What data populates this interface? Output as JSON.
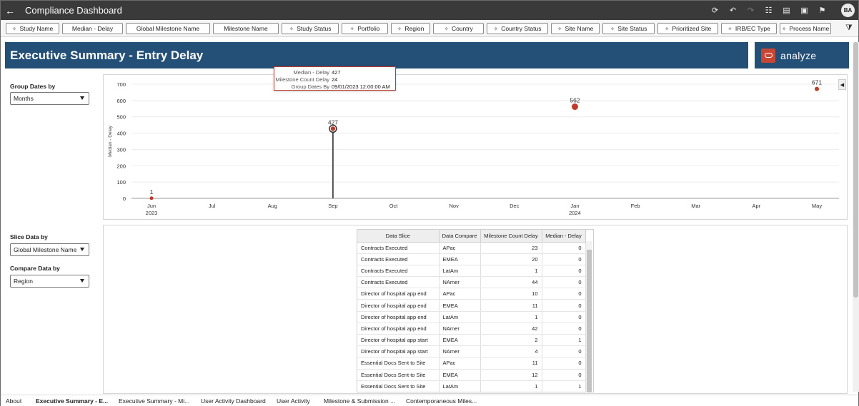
{
  "header": {
    "title": "Compliance Dashboard",
    "avatar": "BA",
    "back_glyph": "←",
    "icons": [
      "refresh-icon",
      "undo-icon",
      "redo-icon",
      "database-icon",
      "comment-icon",
      "export-icon",
      "bookmark-icon"
    ]
  },
  "filters": [
    "Study Name",
    "Median - Delay",
    "Global Milestone Name",
    "Milestone Name",
    "Study Status",
    "Portfolio",
    "Region",
    "Country",
    "Country Status",
    "Site Name",
    "Site Status",
    "Prioritized Site",
    "IRB/EC Type",
    "Process Name"
  ],
  "banner": {
    "title": "Executive Summary - Entry Delay",
    "logo_text": "analyze"
  },
  "controls": {
    "group_dates_label": "Group Dates by",
    "group_dates_value": "Months",
    "slice_label": "Slice Data by",
    "slice_value": "Global Milestone Name",
    "compare_label": "Compare Data by",
    "compare_value": "Region"
  },
  "tooltip": {
    "rows": [
      {
        "key": "Median - Delay",
        "value": "427"
      },
      {
        "key": "Milestone Count Delay",
        "value": "24"
      },
      {
        "key": "Group Dates By",
        "value": "09/01/2023 12:00:00 AM"
      }
    ]
  },
  "chart_data": {
    "type": "scatter",
    "ylabel": "Median - Delay",
    "ylim": [
      0,
      700
    ],
    "yticks": [
      0,
      100,
      200,
      300,
      400,
      500,
      600,
      700
    ],
    "categories": [
      "Jun",
      "Jul",
      "Aug",
      "Sep",
      "Oct",
      "Nov",
      "Dec",
      "Jan",
      "Feb",
      "Mar",
      "Apr",
      "May"
    ],
    "year_labels": [
      {
        "category": "Jun",
        "year": "2023"
      },
      {
        "category": "Jan",
        "year": "2024"
      }
    ],
    "points": [
      {
        "category": "Jun",
        "value": 1,
        "label": "1"
      },
      {
        "category": "Sep",
        "value": 427,
        "label": "427",
        "highlighted": true
      },
      {
        "category": "Jan",
        "value": 562,
        "label": "562"
      },
      {
        "category": "May",
        "value": 671,
        "label": "671"
      }
    ],
    "point_color": "#c0392b",
    "grid": true
  },
  "table": {
    "columns": [
      "Data Slice",
      "Data Compare",
      "Milestone Count Delay",
      "Median - Delay"
    ],
    "rows": [
      [
        "Contracts Executed",
        "APac",
        "23",
        "0"
      ],
      [
        "Contracts Executed",
        "EMEA",
        "20",
        "0"
      ],
      [
        "Contracts Executed",
        "LatAm",
        "1",
        "0"
      ],
      [
        "Contracts Executed",
        "NAmer",
        "44",
        "0"
      ],
      [
        "Director of hospital app end",
        "APac",
        "10",
        "0"
      ],
      [
        "Director of hospital app end",
        "EMEA",
        "11",
        "0"
      ],
      [
        "Director of hospital app end",
        "LatAm",
        "1",
        "0"
      ],
      [
        "Director of hospital app end",
        "NAmer",
        "42",
        "0"
      ],
      [
        "Director of hospital app start",
        "EMEA",
        "2",
        "1"
      ],
      [
        "Director of hospital app start",
        "NAmer",
        "4",
        "0"
      ],
      [
        "Essential Docs Sent to Site",
        "APac",
        "11",
        "0"
      ],
      [
        "Essential Docs Sent to Site",
        "EMEA",
        "12",
        "0"
      ],
      [
        "Essential Docs Sent to Site",
        "LatAm",
        "1",
        "1"
      ]
    ]
  },
  "tabs": [
    {
      "label": "About",
      "active": false
    },
    {
      "label": "Executive Summary - E...",
      "active": true
    },
    {
      "label": "Executive Summary - Mi...",
      "active": false
    },
    {
      "label": "User Activity Dashboard",
      "active": false
    },
    {
      "label": "User Activity",
      "active": false
    },
    {
      "label": "Milestone & Submission ...",
      "active": false
    },
    {
      "label": "Contemporaneous Miles...",
      "active": false
    }
  ],
  "colors": {
    "banner": "#244f77",
    "accent": "#c74634",
    "topbar": "#3a3a3a"
  }
}
